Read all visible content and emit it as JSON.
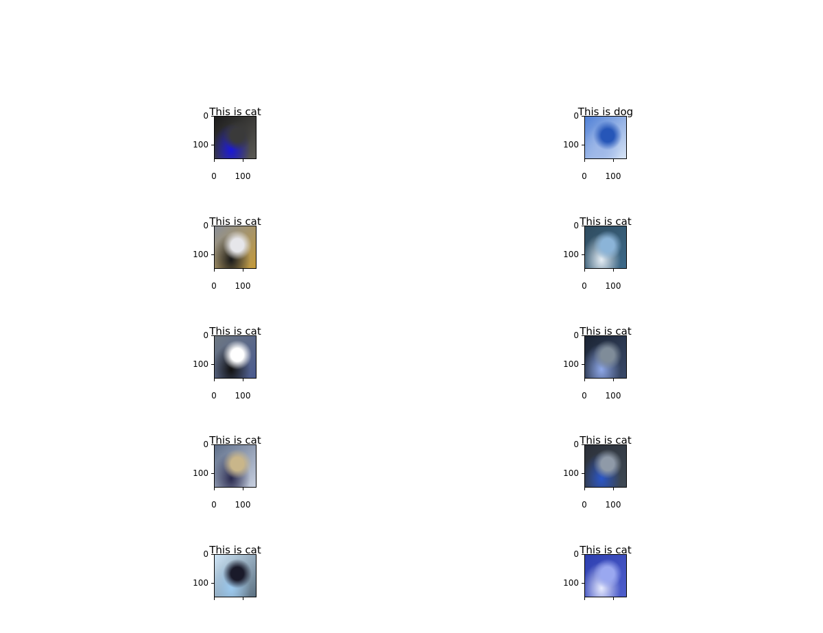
{
  "figure": {
    "panels": [
      {
        "title": "This is cat",
        "yticks": [
          "0",
          "100"
        ],
        "xticks": [
          "0",
          "100"
        ],
        "palette": [
          "#1c1c1c",
          "#3a3a3a",
          "#1a18d8",
          "#5b5a55"
        ]
      },
      {
        "title": "This is dog",
        "yticks": [
          "0",
          "100"
        ],
        "xticks": [
          "0",
          "100"
        ],
        "palette": [
          "#4f7fd6",
          "#2656b8",
          "#9fb8e8",
          "#d8e4f5"
        ]
      },
      {
        "title": "This is cat",
        "yticks": [
          "0",
          "100"
        ],
        "xticks": [
          "0",
          "100"
        ],
        "palette": [
          "#8a8f98",
          "#e6e6ea",
          "#1a1a1a",
          "#c49a3a"
        ]
      },
      {
        "title": "This is cat",
        "yticks": [
          "0",
          "100"
        ],
        "xticks": [
          "0",
          "100"
        ],
        "palette": [
          "#2f4b5e",
          "#8bb4d8",
          "#e6eef5",
          "#3d6a8a"
        ]
      },
      {
        "title": "This is cat",
        "yticks": [
          "0",
          "100"
        ],
        "xticks": [
          "0",
          "100"
        ],
        "palette": [
          "#6e7882",
          "#ffffff",
          "#111111",
          "#4a5a8f"
        ]
      },
      {
        "title": "This is cat",
        "yticks": [
          "0",
          "100"
        ],
        "xticks": [
          "0",
          "100"
        ],
        "palette": [
          "#1b2433",
          "#7f8c99",
          "#8fa8e8",
          "#3a4a6a"
        ]
      },
      {
        "title": "This is cat",
        "yticks": [
          "0",
          "100"
        ],
        "xticks": [
          "0",
          "100"
        ],
        "palette": [
          "#5f6f8a",
          "#c9b68a",
          "#2a2a4f",
          "#c8d0e0"
        ]
      },
      {
        "title": "This is cat",
        "yticks": [
          "0",
          "100"
        ],
        "xticks": [
          "0",
          "100"
        ],
        "palette": [
          "#2b2f38",
          "#8f9aa8",
          "#2b56c8",
          "#3f4a55"
        ]
      },
      {
        "title": "This is cat",
        "yticks": [
          "0",
          "100"
        ],
        "xticks": [],
        "palette": [
          "#cfe6f8",
          "#1a1a2a",
          "#9ccaf0",
          "#5a6f80"
        ]
      },
      {
        "title": "This is cat",
        "yticks": [
          "0",
          "100"
        ],
        "xticks": [],
        "palette": [
          "#2d3fb0",
          "#9aa8f0",
          "#e8ecff",
          "#4f5fcc"
        ]
      }
    ]
  }
}
